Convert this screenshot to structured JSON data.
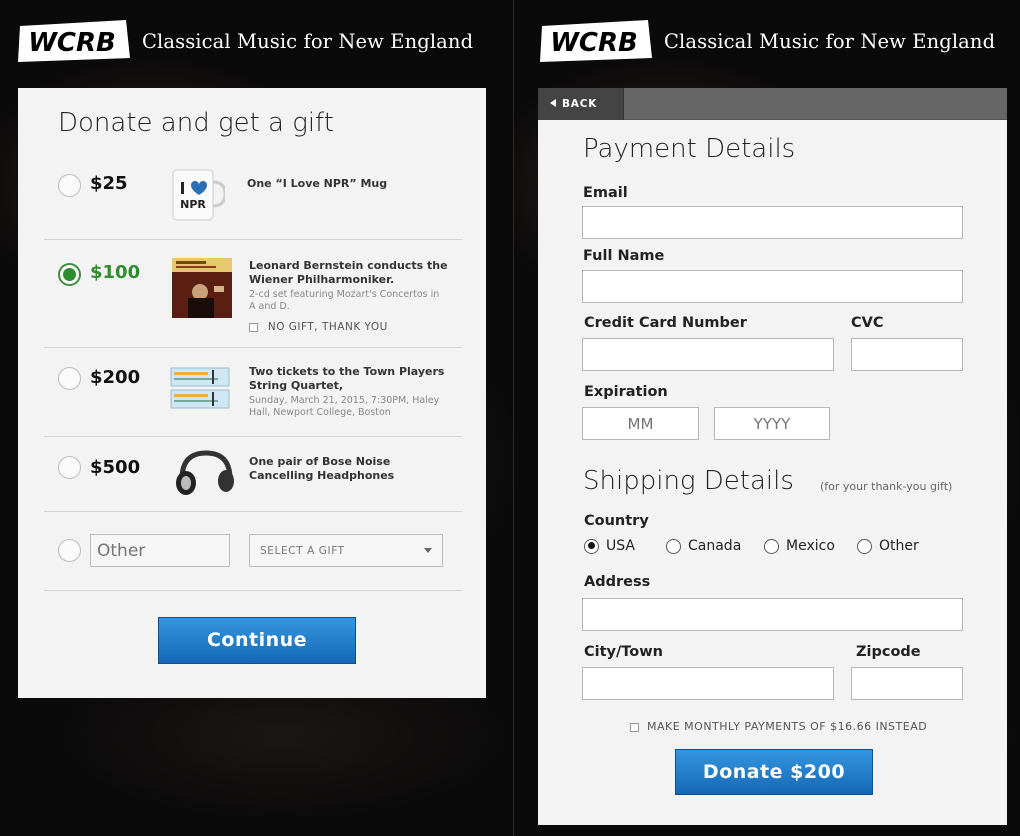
{
  "header": {
    "logo_text": "WCRB",
    "tagline": "Classical Music for New England"
  },
  "donate": {
    "title": "Donate and get a gift",
    "options": [
      {
        "amount": "$25",
        "gift_title": "One “I Love NPR” Mug",
        "gift_sub": "",
        "selected": false
      },
      {
        "amount": "$100",
        "gift_title": "Leonard Bernstein conducts the Wiener Philharmoniker.",
        "gift_sub": "2-cd set featuring Mozart's Concertos in A and D.",
        "selected": true
      },
      {
        "amount": "$200",
        "gift_title": "Two tickets to the Town Players String Quartet,",
        "gift_sub": "Sunday, March 21, 2015, 7:30PM, Haley Hall, Newport College, Boston",
        "selected": false
      },
      {
        "amount": "$500",
        "gift_title": "One pair of Bose Noise Cancelling Headphones",
        "gift_sub": "",
        "selected": false
      }
    ],
    "no_gift_label": "NO GIFT, THANK YOU",
    "other_placeholder": "Other",
    "select_gift_label": "SELECT A GIFT",
    "continue_label": "Continue",
    "mug_text": "NPR"
  },
  "payment": {
    "back_label": "BACK",
    "title": "Payment Details",
    "email_label": "Email",
    "fullname_label": "Full Name",
    "card_label": "Credit Card Number",
    "cvc_label": "CVC",
    "expiration_label": "Expiration",
    "mm_placeholder": "MM",
    "yyyy_placeholder": "YYYY"
  },
  "shipping": {
    "title": "Shipping Details",
    "note": "(for your thank-you gift)",
    "country_label": "Country",
    "countries": [
      "USA",
      "Canada",
      "Mexico",
      "Other"
    ],
    "selected_country": "USA",
    "address_label": "Address",
    "city_label": "City/Town",
    "zip_label": "Zipcode",
    "monthly_label": "MAKE MONTHLY PAYMENTS OF $16.66 INSTEAD",
    "donate_label": "Donate $200"
  },
  "colors": {
    "accent_green": "#2f8c2f",
    "button_blue": "#1f7fd0",
    "card_bg": "#f3f3f3"
  }
}
